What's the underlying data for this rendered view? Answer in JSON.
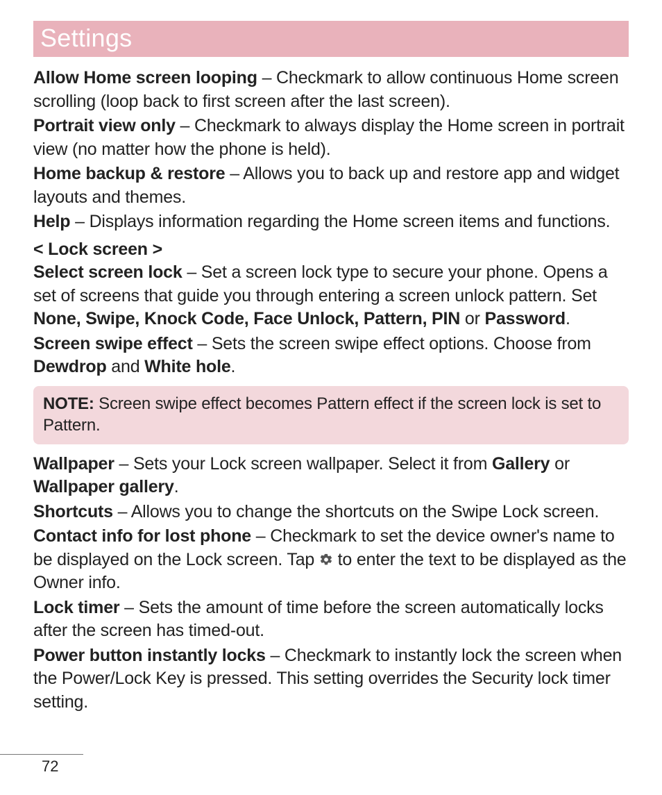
{
  "title": "Settings",
  "p1": {
    "label": "Allow Home screen looping",
    "text": " – Checkmark to allow continuous Home screen scrolling (loop back to first screen after the last screen)."
  },
  "p2": {
    "label": "Portrait view only",
    "text": " – Checkmark to always display the Home screen in portrait view (no matter how the phone is held)."
  },
  "p3": {
    "label": "Home backup & restore",
    "text": " – Allows you to back up and restore app and widget layouts and themes."
  },
  "p4": {
    "label": "Help",
    "text": " – Displays information regarding the Home screen items and functions."
  },
  "sect1": "< Lock screen >",
  "p5": {
    "label": "Select screen lock",
    "t1": " – Set a screen lock type to secure your phone. Opens a set of screens that guide you through entering a screen unlock pattern. Set ",
    "opts": "None, Swipe, Knock Code, Face Unlock, Pattern, PIN",
    "t2": " or ",
    "opt2": "Password",
    "t3": "."
  },
  "p6": {
    "label": "Screen swipe effect",
    "t1": " – Sets the screen swipe effect options. Choose from ",
    "o1": "Dewdrop",
    "t2": " and ",
    "o2": "White hole",
    "t3": "."
  },
  "note": {
    "label": "NOTE:",
    "text": " Screen swipe effect becomes Pattern effect if the screen lock is set to Pattern."
  },
  "p7": {
    "label": "Wallpaper",
    "t1": " – Sets your Lock screen wallpaper. Select it from ",
    "o1": "Gallery",
    "t2": " or ",
    "o2": "Wallpaper gallery",
    "t3": "."
  },
  "p8": {
    "label": "Shortcuts",
    "text": " – Allows you to change the shortcuts on the Swipe Lock screen."
  },
  "p9": {
    "label": "Contact info for lost phone",
    "t1": " – Checkmark to set the device owner's name to be displayed on the Lock screen. Tap ",
    "t2": " to enter the text to be displayed as the Owner info."
  },
  "p10": {
    "label": "Lock timer",
    "text": " – Sets the amount of time before the screen automatically locks after the screen has timed-out."
  },
  "p11": {
    "label": "Power button instantly locks",
    "text": " – Checkmark to instantly lock the screen when the Power/Lock Key is pressed. This setting overrides the Security lock timer setting."
  },
  "pageNumber": "72"
}
